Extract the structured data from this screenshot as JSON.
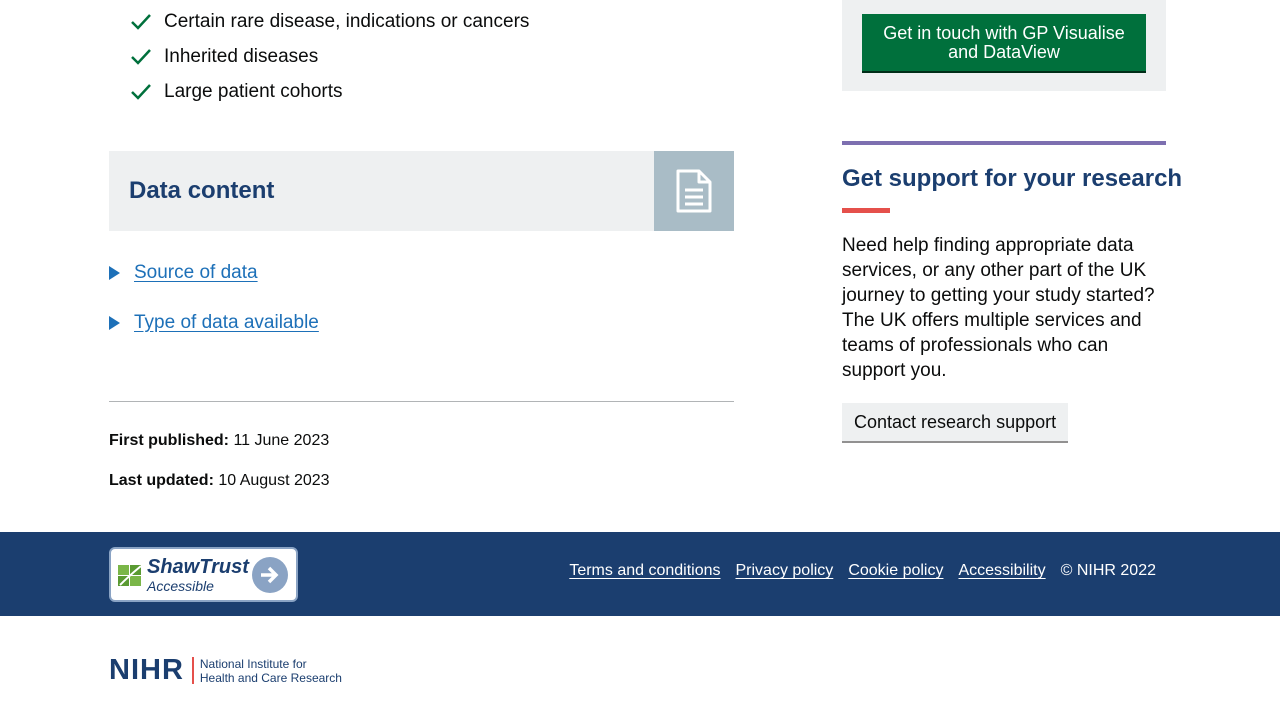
{
  "eligibility": {
    "items": [
      "Certain rare disease, indications or cancers",
      "Inherited diseases",
      "Large patient cohorts"
    ],
    "icon": "checkmark-icon",
    "color": "#00703c"
  },
  "data_content": {
    "title": "Data content",
    "icon": "document-icon",
    "details": [
      "Source of data",
      "Type of data available"
    ]
  },
  "meta": {
    "first_published_label": "First published:",
    "first_published_value": "11 June 2023",
    "last_updated_label": "Last updated:",
    "last_updated_value": "10 August 2023"
  },
  "cta": {
    "button_label": "Get in touch with GP Visualise and DataView"
  },
  "support": {
    "title": "Get support for your research",
    "text": "Need help finding appropriate data services, or any other part of the UK journey to getting your study started? The UK offers multiple services and teams of professionals who can support you.",
    "button_label": "Contact research support"
  },
  "footer": {
    "badge": {
      "name": "ShawTrust",
      "sub": "Accessible"
    },
    "links": [
      "Terms and conditions",
      "Privacy policy",
      "Cookie policy",
      "Accessibility"
    ],
    "copyright": "© NIHR 2022"
  },
  "logo": {
    "mark": "NIHR",
    "line1": "National Institute for",
    "line2": "Health and Care Research"
  },
  "colors": {
    "brand_navy": "#1b3e6f",
    "link_blue": "#1d70b8",
    "cta_green": "#00703c",
    "accent_purple": "#7d6fb0",
    "accent_red": "#e5504b"
  }
}
